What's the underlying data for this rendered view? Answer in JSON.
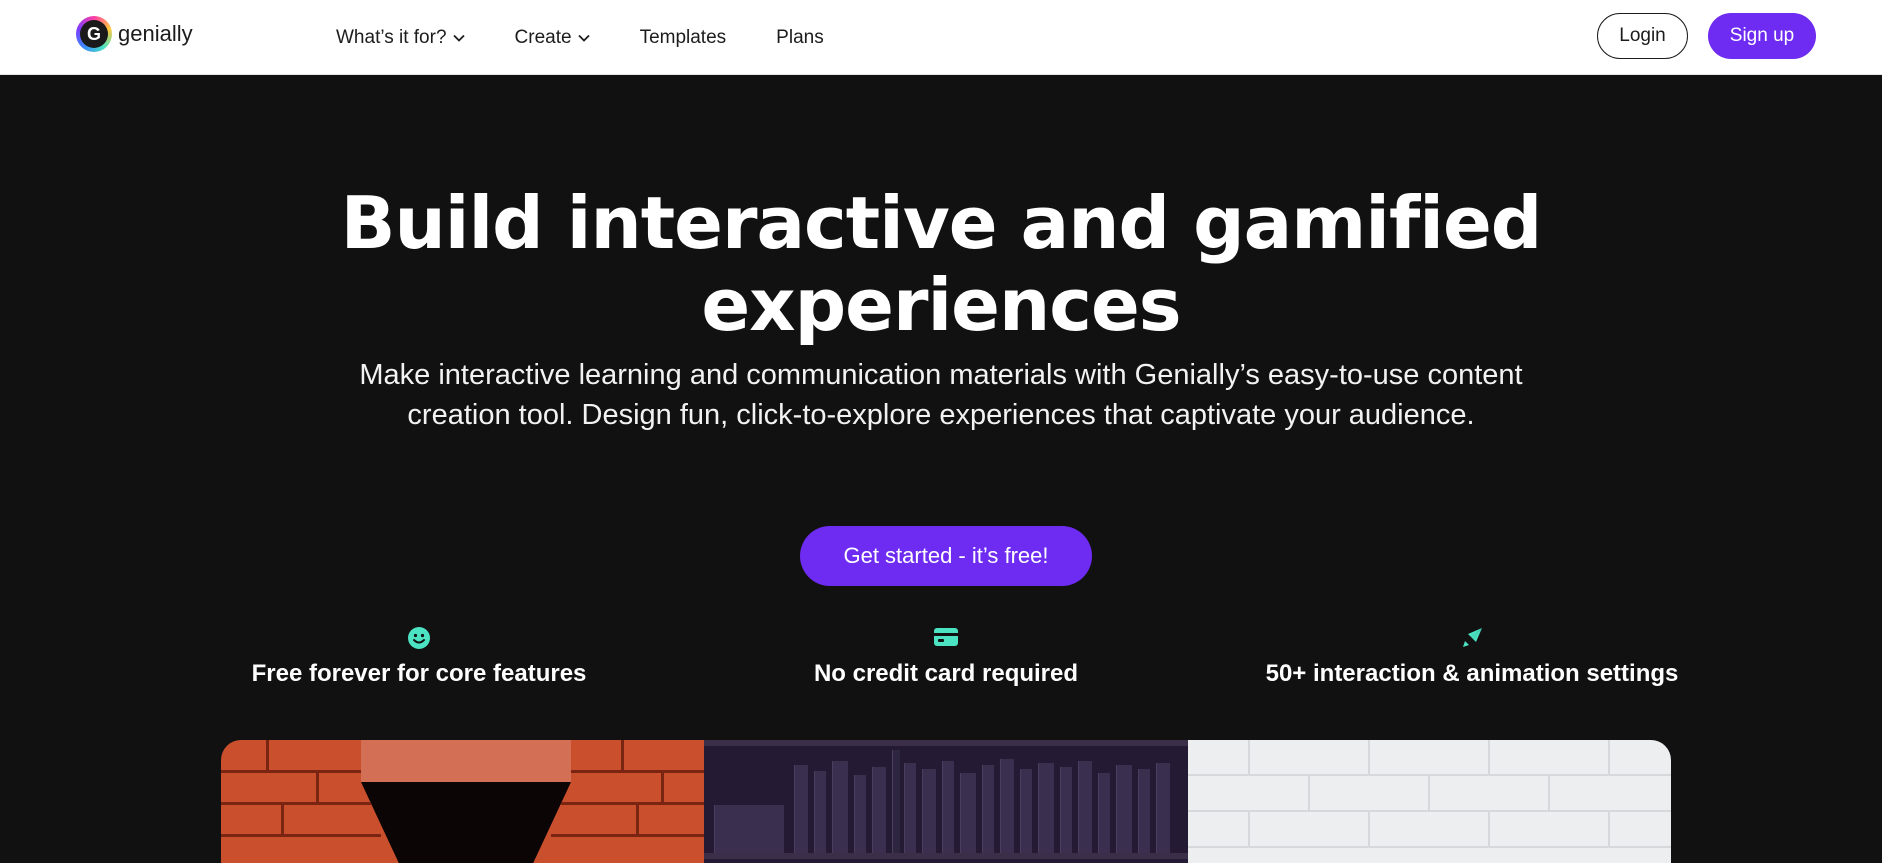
{
  "header": {
    "logo_text": "genially",
    "nav": [
      {
        "label": "What’s it for?",
        "has_dropdown": true
      },
      {
        "label": "Create",
        "has_dropdown": true
      },
      {
        "label": "Templates",
        "has_dropdown": false
      },
      {
        "label": "Plans",
        "has_dropdown": false
      }
    ],
    "login_label": "Login",
    "signup_label": "Sign up"
  },
  "hero": {
    "title_line1": "Build interactive and gamified",
    "title_line2": "experiences",
    "subtitle": "Make interactive learning and communication materials with Genially’s easy-to-use content creation tool. Design fun, click-to-explore experiences that captivate your audience.",
    "cta_label": "Get started - it’s free!"
  },
  "features": [
    {
      "icon": "smile-icon",
      "label": "Free forever for core features"
    },
    {
      "icon": "credit-card-icon",
      "label": "No credit card required"
    },
    {
      "icon": "rocket-icon",
      "label": "50+ interaction & animation settings"
    }
  ],
  "colors": {
    "brand": "#6e2bf1",
    "hero_bg": "#121112",
    "feature_icon": "#4be3c2"
  }
}
